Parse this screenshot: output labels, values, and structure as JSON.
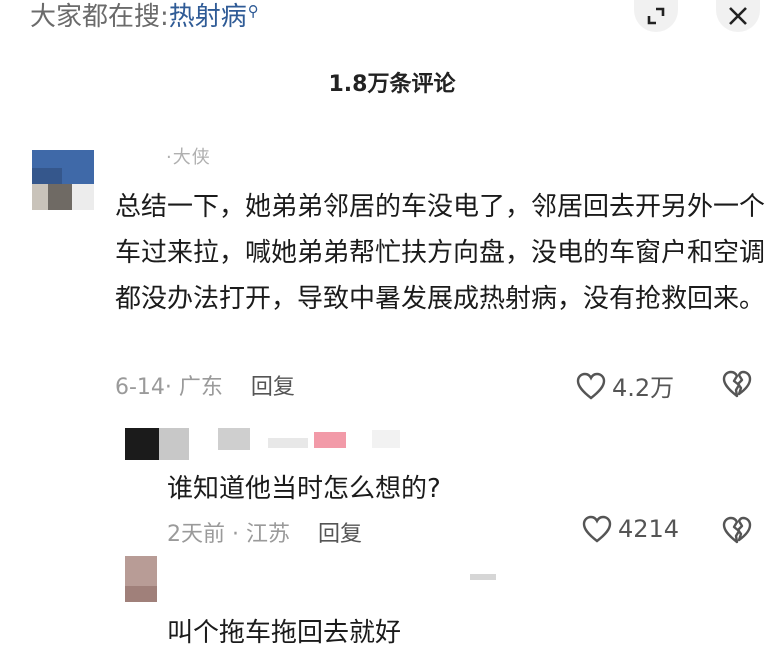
{
  "search": {
    "prefix": "大家都在搜:",
    "keyword": "热射病"
  },
  "comments_header": {
    "title": "1.8万条评论"
  },
  "top_comment": {
    "username": "·大侠",
    "text": "总结一下，她弟弟邻居的车没电了，邻居回去开另外一个车过来拉，喊她弟弟帮忙扶方向盘，没电的车窗户和空调都没办法打开，导致中暑发展成热射病，没有抢救回来。",
    "date_location": "6-14· 广东",
    "reply_label": "回复",
    "likes": "4.2万"
  },
  "reply_1": {
    "text": "谁知道他当时怎么想的?",
    "date_location": "2天前 · 江苏",
    "reply_label": "回复",
    "likes": "4214"
  },
  "reply_2": {
    "text": "叫个拖车拖回去就好"
  },
  "icons": {
    "search": "search-icon",
    "minimize": "collapse-icon",
    "close": "close-icon",
    "like": "heart-icon",
    "dislike": "broken-heart-icon"
  },
  "colors": {
    "keyword": "#2f5b96",
    "meta": "#9a9a9a",
    "background": "#ffffff"
  }
}
